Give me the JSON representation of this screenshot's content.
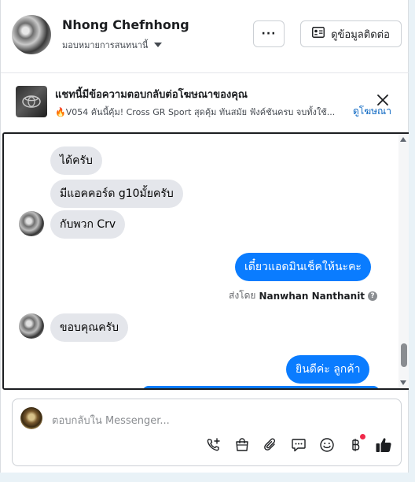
{
  "header": {
    "contact_name": "Nhong Chefnhong",
    "assign_label": "มอบหมายการสนทนานี้",
    "more_label": "···",
    "contact_info_label": "ดูข้อมูลติดต่อ"
  },
  "ad_banner": {
    "title": "แชทนี้มีข้อความตอบกลับต่อโฆษณาของคุณ",
    "subtitle": "🔥V054 คันนี้คุ้ม! Cross GR Sport สุดคุ้ม ทันสมัย ฟังค์ชันครบ จบทั้งใช้...",
    "link_label": "ดูโฆษณา"
  },
  "messages": [
    {
      "direction": "in",
      "text": "ได้ครับ"
    },
    {
      "direction": "in",
      "text": "มีแอคคอร์ด g10มั้ยครับ"
    },
    {
      "direction": "in",
      "text": "กับพวก Crv"
    },
    {
      "direction": "out",
      "text": "เดี๋ยวแอดมินเช็คให้นะคะ"
    },
    {
      "direction": "in",
      "text": "ขอบคุณครับ"
    },
    {
      "direction": "out",
      "text": "ยินดีค่ะ  ลูกค้า"
    }
  ],
  "sent_by": {
    "prefix": "ส่งโดย",
    "name": "Nanwhan Nanthanit",
    "info_mark": "?"
  },
  "reply": {
    "placeholder": "ตอบกลับใน Messenger..."
  },
  "toolbar_icons": [
    "call-add-icon",
    "shopping-bag-icon",
    "paperclip-icon",
    "saved-replies-icon",
    "emoji-icon",
    "baht-icon",
    "thumbs-up-icon"
  ],
  "colors": {
    "accent": "#0a7cff",
    "incoming_bubble": "#e4e6eb",
    "notification": "#f02849",
    "link": "#0a66c2"
  }
}
